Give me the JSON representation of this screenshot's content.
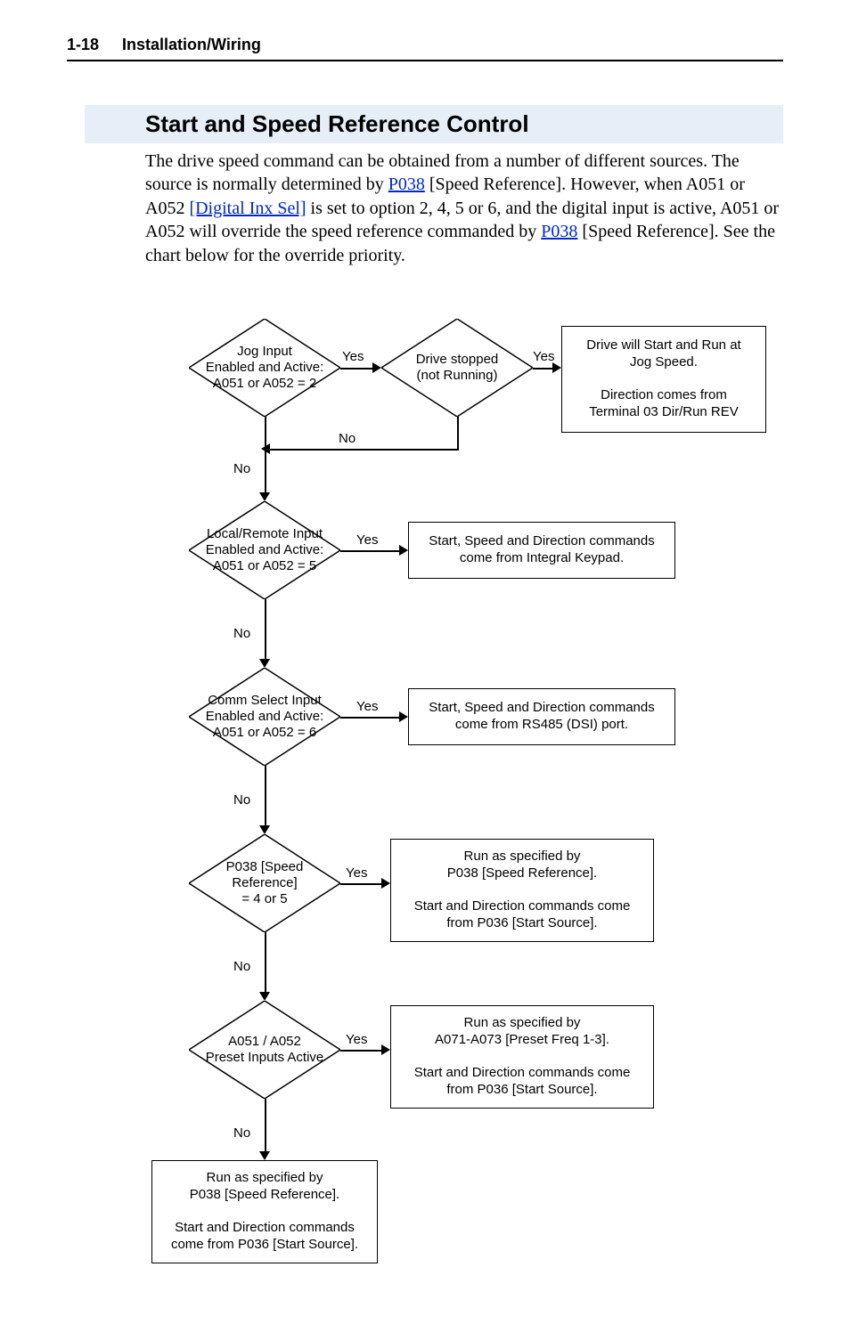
{
  "header": {
    "page_num": "1-18",
    "section": "Installation/Wiring"
  },
  "heading": "Start and Speed Reference Control",
  "paragraph": {
    "t1": "The drive speed command can be obtained from a number of different sources. The source is normally determined by ",
    "l1": "P038",
    "t2": " [Speed Reference]. However, when A051 or A052 ",
    "l2": "[Digital Inx Sel]",
    "t3": " is set to option 2, 4, 5 or 6, and the digital input is active, A051 or A052 will override the speed reference commanded by ",
    "l3": "P038",
    "t4": " [Speed Reference]. See the chart below for the override priority."
  },
  "labels": {
    "yes": "Yes",
    "no": "No"
  },
  "d1": "Jog Input\nEnabled and Active:\nA051 or A052 = 2",
  "d2": "Drive stopped\n(not Running)",
  "b1": "Drive will Start and Run at\nJog Speed.\n\nDirection comes from\nTerminal 03 Dir/Run REV",
  "d3": "Local/Remote Input\nEnabled and Active:\nA051 or A052 = 5",
  "b2": "Start, Speed and Direction commands\ncome from Integral Keypad.",
  "d4": "Comm Select Input\nEnabled and Active:\nA051 or A052 = 6",
  "b3": "Start, Speed and Direction commands\ncome from RS485 (DSI) port.",
  "d5": "P038 [Speed Reference]\n= 4 or 5",
  "b4": "Run as specified by\nP038 [Speed Reference].\n\nStart and Direction commands come\nfrom P036 [Start Source].",
  "d6": "A051 / A052\nPreset Inputs Active",
  "b5": "Run as specified by\nA071-A073 [Preset Freq 1-3].\n\nStart and Direction commands come\nfrom P036 [Start Source].",
  "b6": "Run as specified by\nP038 [Speed Reference].\n\nStart and Direction commands\ncome from P036 [Start Source]."
}
